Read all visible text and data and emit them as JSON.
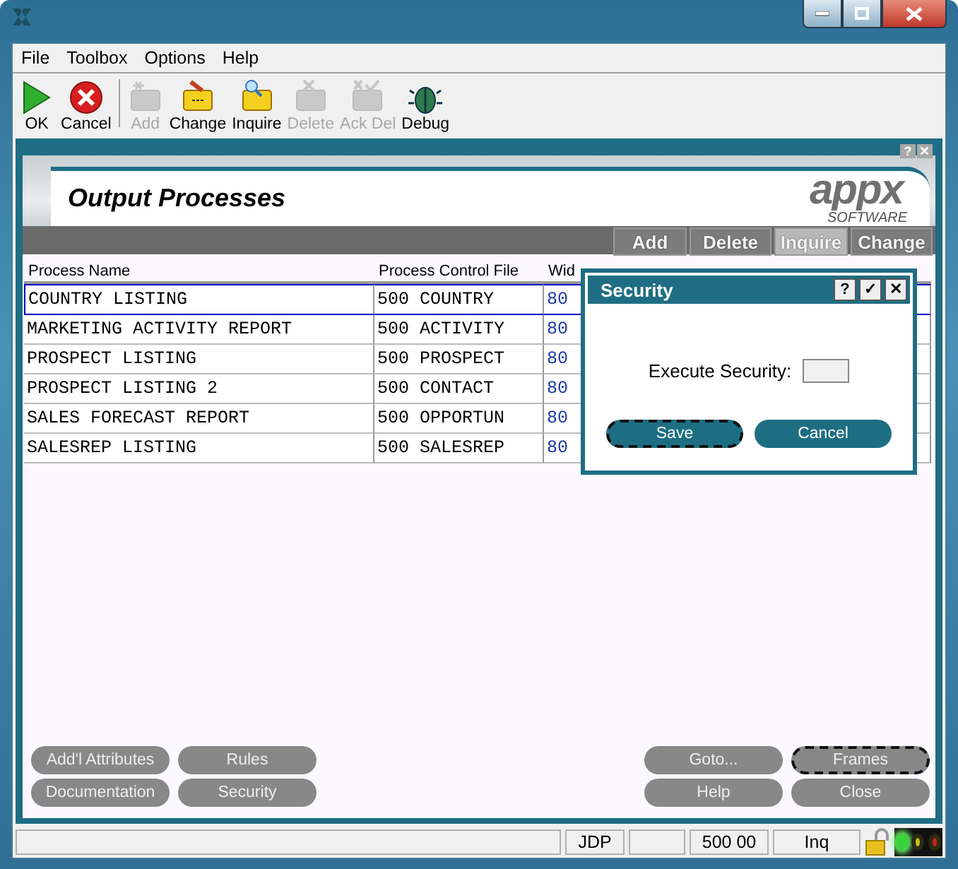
{
  "menu": [
    "File",
    "Toolbox",
    "Options",
    "Help"
  ],
  "toolbar": [
    {
      "label": "OK",
      "disabled": false
    },
    {
      "label": "Cancel",
      "disabled": false
    },
    {
      "label": "Add",
      "disabled": true
    },
    {
      "label": "Change",
      "disabled": false
    },
    {
      "label": "Inquire",
      "disabled": false
    },
    {
      "label": "Delete",
      "disabled": true
    },
    {
      "label": "Ack Del",
      "disabled": true
    },
    {
      "label": "Debug",
      "disabled": false
    }
  ],
  "form": {
    "panel_buttons": [
      "?",
      "✕"
    ],
    "title": "Output Processes",
    "logo": {
      "word": "appx",
      "tagline": "SOFTWARE"
    },
    "actions": [
      {
        "label": "Add",
        "selected": false
      },
      {
        "label": "Delete",
        "selected": false
      },
      {
        "label": "Inquire",
        "selected": true
      },
      {
        "label": "Change",
        "selected": false
      }
    ]
  },
  "table": {
    "columns": [
      "Process Name",
      "Process Control File",
      "Wid"
    ],
    "rows": [
      {
        "cells": [
          "COUNTRY LISTING",
          "500 COUNTRY",
          "80"
        ],
        "selected": true
      },
      {
        "cells": [
          "MARKETING ACTIVITY REPORT",
          "500 ACTIVITY",
          "80"
        ],
        "selected": false
      },
      {
        "cells": [
          "PROSPECT LISTING",
          "500 PROSPECT",
          "80"
        ],
        "selected": false
      },
      {
        "cells": [
          "PROSPECT LISTING 2",
          "500 CONTACT",
          "80"
        ],
        "selected": false
      },
      {
        "cells": [
          "SALES FORECAST REPORT",
          "500 OPPORTUN",
          "80"
        ],
        "selected": false
      },
      {
        "cells": [
          "SALESREP LISTING",
          "500 SALESREP",
          "80"
        ],
        "selected": false
      }
    ]
  },
  "dialog": {
    "title": "Security",
    "title_buttons": [
      "?",
      "✓",
      "✕"
    ],
    "field_label": "Execute Security:",
    "buttons": [
      {
        "label": "Save",
        "focused": true
      },
      {
        "label": "Cancel",
        "focused": false
      }
    ]
  },
  "bottom_buttons": {
    "left": [
      {
        "label": "Add'l Attributes",
        "focused": false
      },
      {
        "label": "Rules",
        "focused": false
      },
      {
        "label": "Documentation",
        "focused": false
      },
      {
        "label": "Security",
        "focused": false
      }
    ],
    "right": [
      {
        "label": "Goto...",
        "focused": false
      },
      {
        "label": "Frames",
        "focused": true
      },
      {
        "label": "Help",
        "focused": false
      },
      {
        "label": "Close",
        "focused": false
      }
    ]
  },
  "status_bar": {
    "user": "JDP",
    "app": "500 00",
    "mode": "Inq",
    "lights": [
      {
        "color": "#3ad23a",
        "on": true
      },
      {
        "color": "#c8c020",
        "on": false
      },
      {
        "color": "#d02020",
        "on": false
      }
    ]
  }
}
